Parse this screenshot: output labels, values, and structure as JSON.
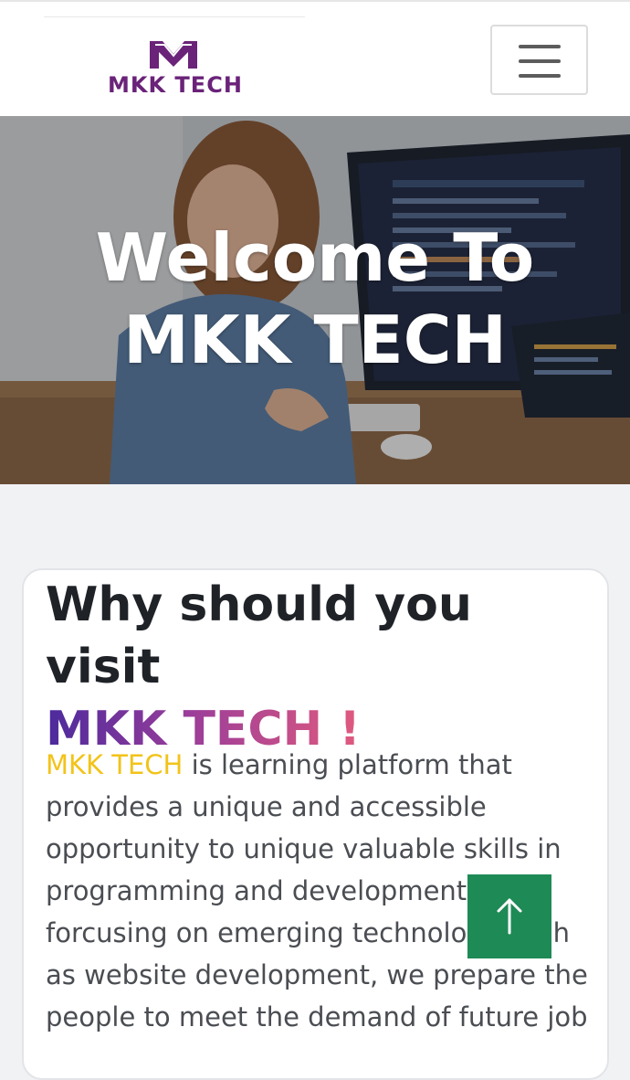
{
  "header": {
    "logo_text": "MKK TECH",
    "menu_icon": "hamburger-icon"
  },
  "hero": {
    "title_line1": "Welcome To",
    "title_line2": "MKK TECH"
  },
  "card": {
    "title_prefix": "Why should you visit",
    "title_brand": "MKK TECH !",
    "body_brand": "MKK TECH",
    "body_text": " is learning platform that provides a unique and accessible opportunity to unique valuable skills in programming and development. forcusing on emerging technology such as website development, we prepare the people to meet the demand of future job"
  },
  "scroll_top": {
    "icon": "arrow-up-icon"
  },
  "colors": {
    "brand_purple": "#6a2379",
    "highlight_yellow": "#f2c31a",
    "button_green": "#1e8a55"
  }
}
